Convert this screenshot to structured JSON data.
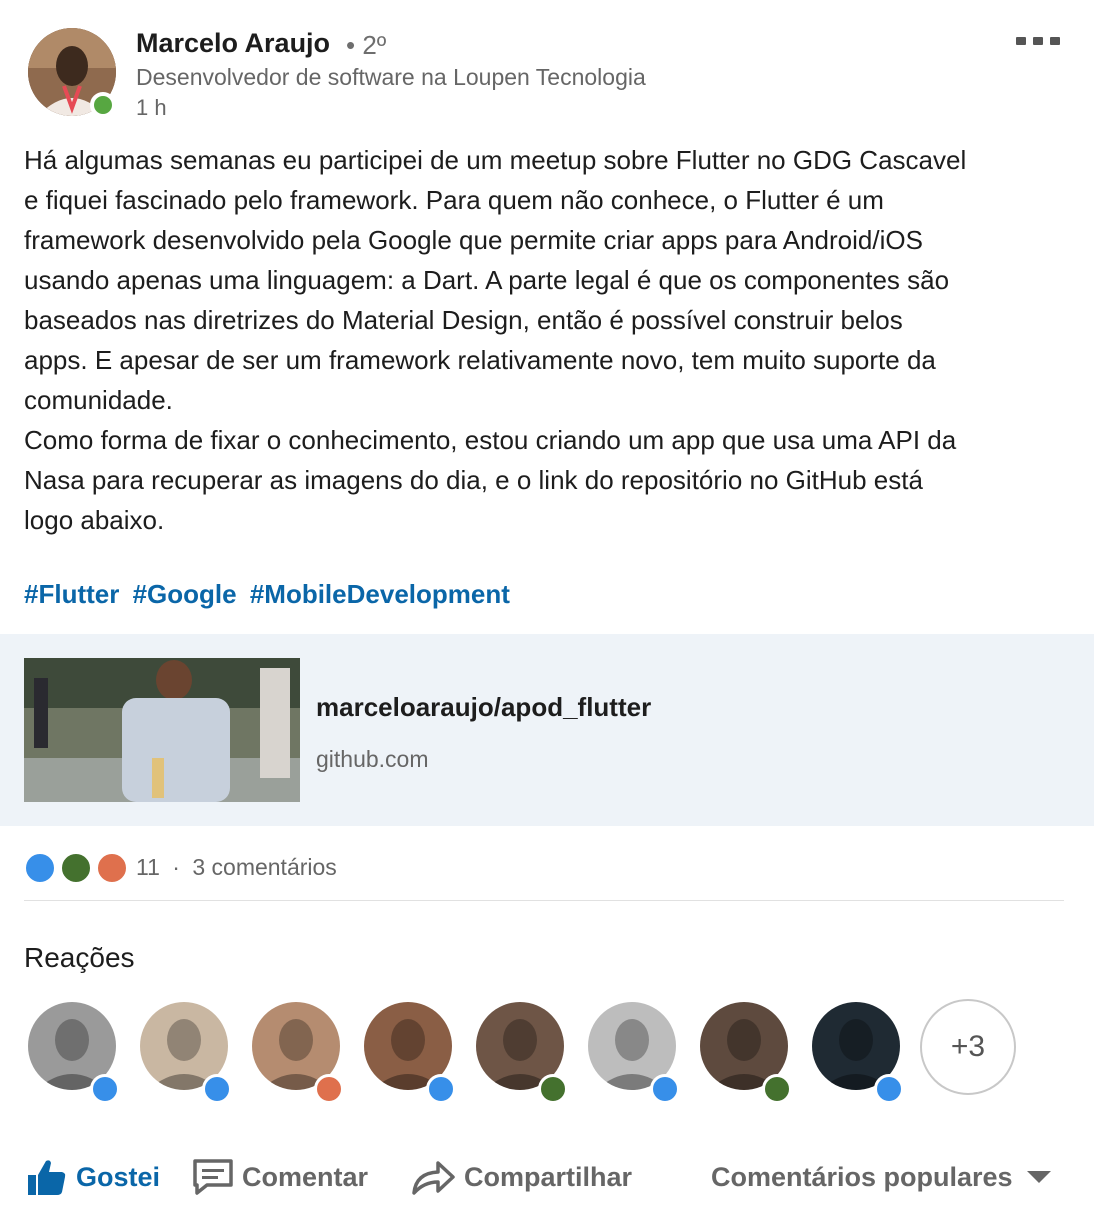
{
  "post": {
    "author": {
      "name": "Marcelo Araujo",
      "degree": "• 2º",
      "headline": "Desenvolvedor de software na Loupen Tecnologia",
      "time": "1 h"
    },
    "text_lines": [
      "Há algumas semanas eu participei de um meetup sobre Flutter no GDG Cascavel",
      "e fiquei fascinado pelo framework. Para quem não conhece,  o Flutter é um",
      "framework desenvolvido pela Google que permite criar apps para Android/iOS",
      "usando apenas uma linguagem: a Dart. A parte legal é que os componentes são",
      "baseados nas diretrizes do Material Design, então é possível construir belos",
      "apps. E apesar de ser um framework relativamente novo, tem muito suporte da",
      "comunidade.",
      "Como forma de fixar o conhecimento, estou criando um app que usa uma API da",
      "Nasa para recuperar as imagens do dia, e o link do repositório no GitHub está",
      "logo abaixo."
    ],
    "hashtags": [
      "#Flutter",
      "#Google",
      "#MobileDevelopment"
    ],
    "link": {
      "title": "marceloaraujo/apod_flutter",
      "domain": "github.com"
    },
    "reaction_count": "11",
    "comments": "3 comentários",
    "reaction_icons": [
      "like-icon",
      "celebrate-icon",
      "love-icon"
    ]
  },
  "reactions": {
    "title": "Reações",
    "reactors": [
      {
        "badge": "like",
        "color": "#9a9a9a"
      },
      {
        "badge": "like",
        "color": "#c9b7a2"
      },
      {
        "badge": "love",
        "color": "#b58c70"
      },
      {
        "badge": "like",
        "color": "#8a5e45"
      },
      {
        "badge": "celebrate",
        "color": "#6e5546"
      },
      {
        "badge": "like",
        "color": "#bdbdbd"
      },
      {
        "badge": "celebrate",
        "color": "#5e4a3e"
      },
      {
        "badge": "like",
        "color": "#1f2a33"
      }
    ],
    "more": "+3"
  },
  "actions": {
    "like": "Gostei",
    "comment": "Comentar",
    "share": "Compartilhar",
    "sort": "Comentários populares"
  },
  "colors": {
    "link_blue": "#0a66a8",
    "like_blue": "#378fe9",
    "love_orange": "#df704d",
    "celebrate_green": "#44712e",
    "online_green": "#57a741",
    "card_bg": "#eef3f8"
  }
}
